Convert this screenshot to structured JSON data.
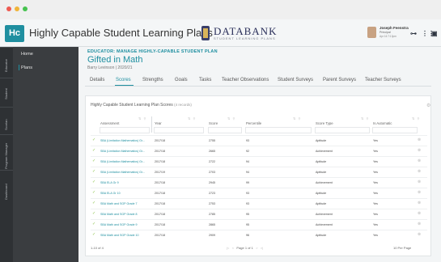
{
  "app": {
    "logo": "Hc",
    "title": "Highly Capable Student Learning Plans",
    "brand": "DATABANK",
    "brand_sub": "STUDENT LEARNING PLANS",
    "user": {
      "name": "Joseph Feenstra",
      "role": "Principal",
      "date": "Apr 16 7:13pm"
    },
    "icons": [
      "network-icon",
      "grid-icon",
      "tile-icon"
    ]
  },
  "rail": [
    "Educator",
    "Student",
    "Scorlan",
    "Program Manager",
    "Dashboard"
  ],
  "nav": {
    "home": "Home",
    "plans": "Plans"
  },
  "header": {
    "crumb": "EDUCATOR: MANAGE HIGHLY-CAPABLE STUDENT PLAN",
    "title": "Gifted in Math",
    "sub": "Barry Levinson | 2020/21"
  },
  "tabs": [
    "Details",
    "Scores",
    "Strengths",
    "Goals",
    "Tasks",
    "Teacher Observations",
    "Student Surveys",
    "Parent Surveys",
    "Teacher Surveys"
  ],
  "active_tab": "Scores",
  "card": {
    "title": "Highly Capable Student Learning Plan Scores",
    "count": "(4 records)"
  },
  "columns": [
    "Assessment",
    "Year",
    "Score",
    "Percentile",
    "Score Type",
    "Is Automatic"
  ],
  "rows": [
    [
      "SBA (Limitation Mathematics) Gr...",
      "2017/18",
      "2755",
      "93",
      "Aptitude",
      "Yes"
    ],
    [
      "SBA (Limitation Mathematics) Gr...",
      "2017/18",
      "2665",
      "92",
      "Achievement",
      "Yes"
    ],
    [
      "SBA (Limitation Mathematics) Gr...",
      "2017/18",
      "2722",
      "94",
      "Aptitude",
      "Yes"
    ],
    [
      "SBA (Limitation Mathematics) Gr...",
      "2017/19",
      "2703",
      "94",
      "Aptitude",
      "Yes"
    ],
    [
      "SBA ELA Gr 9",
      "2017/18",
      "2945",
      "99",
      "Achievement",
      "Yes"
    ],
    [
      "SBA ELA Gr 10",
      "2017/18",
      "2723",
      "93",
      "Aptitude",
      "Yes"
    ],
    [
      "SBA Math and SGP Grade 7",
      "2017/18",
      "2753",
      "93",
      "Aptitude",
      "Yes"
    ],
    [
      "SBA Math and SGP Grade 8",
      "2017/18",
      "2785",
      "95",
      "Achievement",
      "Yes"
    ],
    [
      "SBA Math and SGP Grade 9",
      "2017/18",
      "2865",
      "95",
      "Achievement",
      "Yes"
    ],
    [
      "SBA Math and SGP Grade 10",
      "2017/18",
      "2909",
      "96",
      "Aptitude",
      "Yes"
    ]
  ],
  "pager": {
    "left": "1-10 of 4",
    "page": "Page 1 of 1",
    "right": "10 Per Page"
  }
}
